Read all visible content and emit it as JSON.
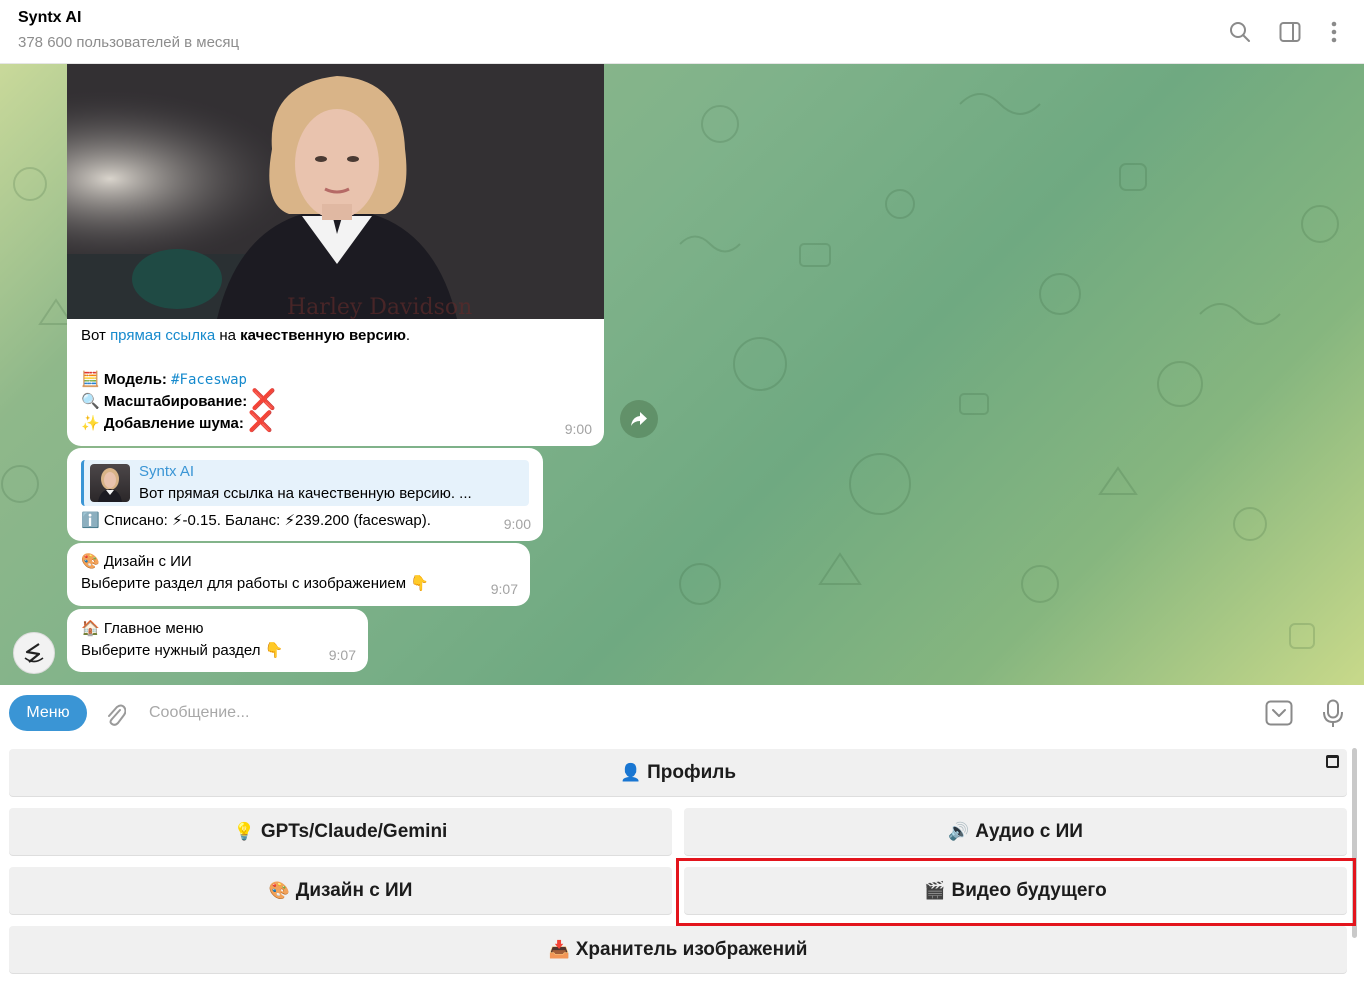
{
  "header": {
    "title": "Syntx AI",
    "subtitle": "378 600 пользователей в месяц",
    "icons": [
      "search-icon",
      "sidebar-toggle-icon",
      "more-vertical-icon"
    ]
  },
  "messages": {
    "m1": {
      "prefix": "Вот ",
      "link": "прямая ссылка",
      "mid": " на ",
      "bold_tail": "качественную версию",
      "dot": ".",
      "model_emoji": "🧮",
      "model_label": "Модель: ",
      "model_tag": "#Faceswap",
      "scale_emoji": "🔍",
      "scale_label": "Масштабирование: ",
      "noise_emoji": "✨",
      "noise_label": "Добавление шума: ",
      "x": "❌",
      "time": "9:00"
    },
    "m2": {
      "reply_name": "Syntx AI",
      "reply_text": "Вот прямая ссылка на качественную версию.  ...",
      "info_emoji": "ℹ️",
      "line": "Списано: ⚡-0.15. Баланс: ⚡239.200 (faceswap).",
      "time": "9:00"
    },
    "m3": {
      "emoji": "🎨",
      "title": "Дизайн с ИИ",
      "text": "Выберите раздел для работы с изображением 👇",
      "time": "9:07"
    },
    "m4": {
      "emoji": "🏠",
      "title": "Главное меню",
      "text": "Выберите нужный раздел 👇",
      "time": "9:07"
    }
  },
  "input": {
    "menu_label": "Меню",
    "placeholder": "Сообщение..."
  },
  "keyboard": {
    "profile": {
      "emoji": "👤",
      "label": "Профиль"
    },
    "gpts": {
      "emoji": "💡",
      "label": "GPTs/Claude/Gemini"
    },
    "audio": {
      "emoji": "🔊",
      "label": "Аудио с ИИ"
    },
    "design": {
      "emoji": "🎨",
      "label": "Дизайн с ИИ"
    },
    "video": {
      "emoji": "🎬",
      "label": "Видео будущего"
    },
    "storage": {
      "emoji": "📥",
      "label": "Хранитель изображений"
    }
  },
  "colors": {
    "accent": "#3a95d5",
    "link": "#168acd",
    "highlight": "#e3141c"
  }
}
